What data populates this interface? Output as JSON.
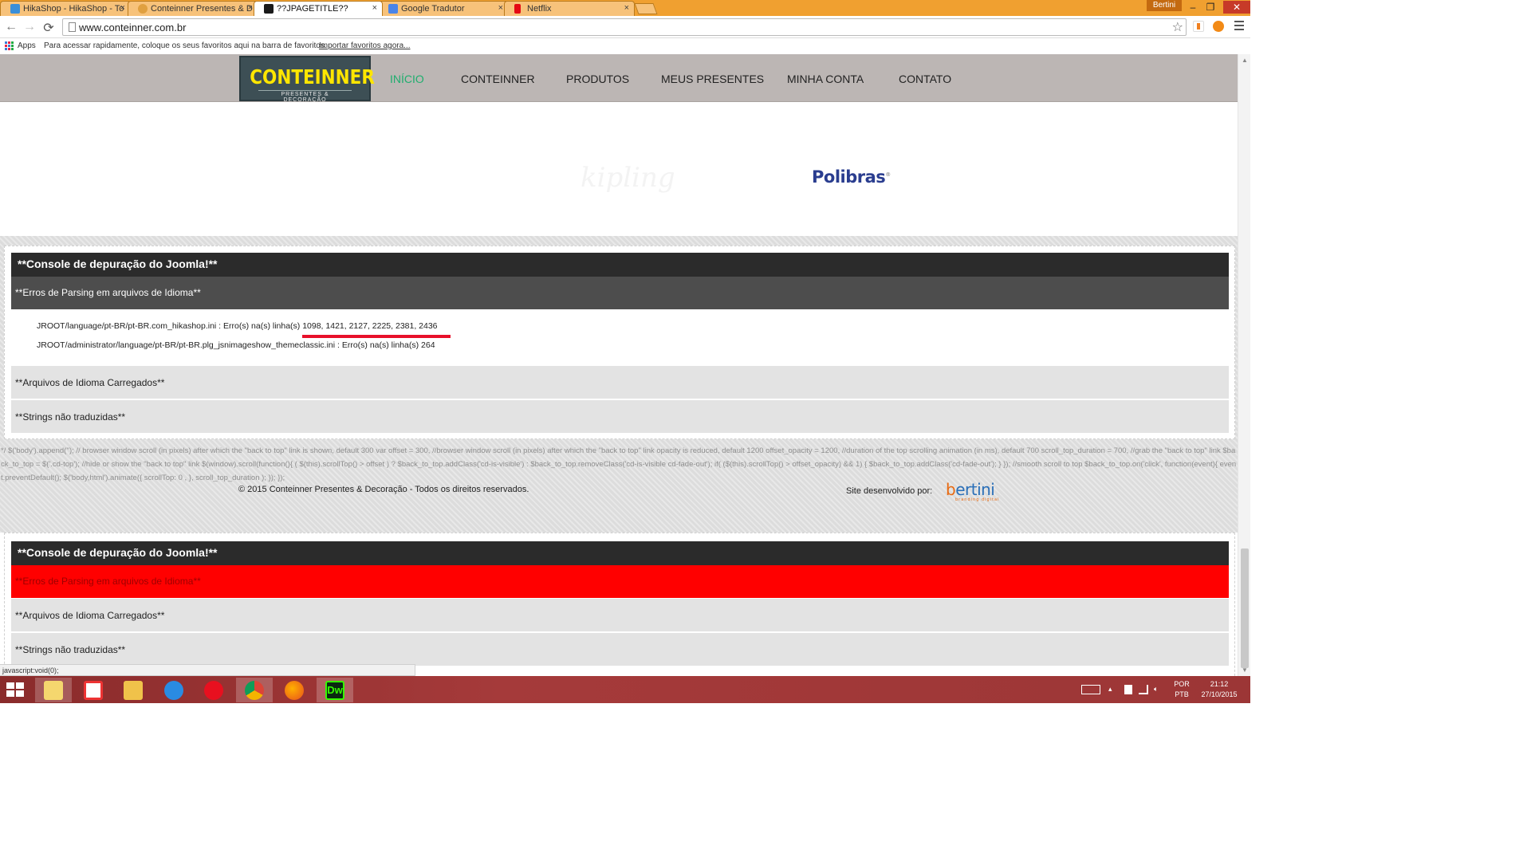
{
  "browser": {
    "tabs": [
      {
        "title": "HikaShop - HikaShop - To",
        "favicon_color": "#3a8fd9"
      },
      {
        "title": "Conteinner Presentes & D",
        "favicon_color": "#e0a040"
      },
      {
        "title": "??JPAGETITLE??",
        "favicon_color": "#1a1a1a",
        "active": true
      },
      {
        "title": "Google Tradutor",
        "favicon_color": "#4a84e8"
      },
      {
        "title": "Netflix",
        "favicon_color": "#e50914"
      }
    ],
    "tab_close_glyph": "×",
    "user_name": "Bertini",
    "window_controls": {
      "minimize": "–",
      "restore": "❐",
      "close": "✕"
    },
    "nav": {
      "back": "←",
      "forward": "→",
      "reload": "⟳"
    },
    "url": "www.conteinner.com.br",
    "bookmarks_bar": {
      "apps_label": "Apps",
      "hint_text": "Para acessar rapidamente, coloque os seus favoritos aqui na barra de favoritos.",
      "import_link": "Importar favoritos agora..."
    },
    "status_url": "javascript:void(0);",
    "icons": [
      "star-icon",
      "extension-icon",
      "avast-icon",
      "menu-icon"
    ]
  },
  "site": {
    "logo": {
      "brand": "CONTEINNER",
      "tagline": "PRESENTES & DECORAÇÃO"
    },
    "menu": [
      {
        "label": "INÍCIO",
        "active": true
      },
      {
        "label": "CONTEINNER"
      },
      {
        "label": "PRODUTOS"
      },
      {
        "label": "MEUS PRESENTES"
      },
      {
        "label": "MINHA CONTA"
      },
      {
        "label": "CONTATO"
      }
    ],
    "partners": [
      {
        "name": "kipling"
      },
      {
        "name": "Polibras",
        "mark": "®"
      }
    ],
    "accent_color": "#1fae6e"
  },
  "console_1": {
    "title": "**Console de depuração do Joomla!**",
    "parsing_header": "**Erros de Parsing em arquivos de Idioma**",
    "errors": [
      {
        "prefix": "JROOT/language/pt-BR/pt-BR.com_hikashop.ini : Erro(s) na(s) linha(s) ",
        "lines": "1098, 1421, 2127, 2225, 2381, 2436"
      },
      {
        "prefix": "JROOT/administrator/language/pt-BR/pt-BR.plg_jsnimageshow_themeclassic.ini : Erro(s) na(s) linha(s) ",
        "lines": "264"
      }
    ],
    "loaded_files": "**Arquivos de Idioma Carregados**",
    "untranslated": "**Strings não traduzidas**"
  },
  "script_leak": "*/ $('body').append(''); // browser window scroll (in pixels) after which the \"back to top\" link is shown, default 300 var offset = 300, //browser window scroll (in pixels) after which the \"back to top\" link opacity is reduced, default 1200 offset_opacity = 1200, //duration of the top scrolling animation (in ms), default 700 scroll_top_duration = 700, //grab the \"back to top\" link $back_to_top = $('.cd-top'); //hide or show the \"back to top\" link $(window).scroll(function(){ ( $(this).scrollTop() > offset ) ? $back_to_top.addClass('cd-is-visible') : $back_to_top.removeClass('cd-is-visible cd-fade-out'); if( ($(this).scrollTop() > offset_opacity) && 1) { $back_to_top.addClass('cd-fade-out'); } }); //smooth scroll to top $back_to_top.on('click', function(event){ event.preventDefault(); $('body,html').animate({ scrollTop: 0 , }, scroll_top_duration ); }); });",
  "footer": {
    "copyright": "© 2015 Conteinner Presentes & Decoração - Todos os direitos reservados.",
    "developed_by": "Site desenvolvido por:",
    "dev_logo": {
      "text_b": "b",
      "text_rest": "ertini",
      "subtitle": "branding digital"
    }
  },
  "console_2": {
    "title": "**Console de depuração do Joomla!**",
    "parsing_header": "**Erros de Parsing em arquivos de Idioma**",
    "loaded_files": "**Arquivos de Idioma Carregados**",
    "untranslated": "**Strings não traduzidas**"
  },
  "taskbar": {
    "apps": [
      "file-explorer-library",
      "windows-store",
      "file-explorer",
      "internet-explorer",
      "opera",
      "chrome",
      "firefox",
      "dreamweaver"
    ],
    "dreamweaver_label": "Dw",
    "language": "POR",
    "keyboard_layout": "PTB",
    "time": "21:12",
    "date": "27/10/2015"
  }
}
